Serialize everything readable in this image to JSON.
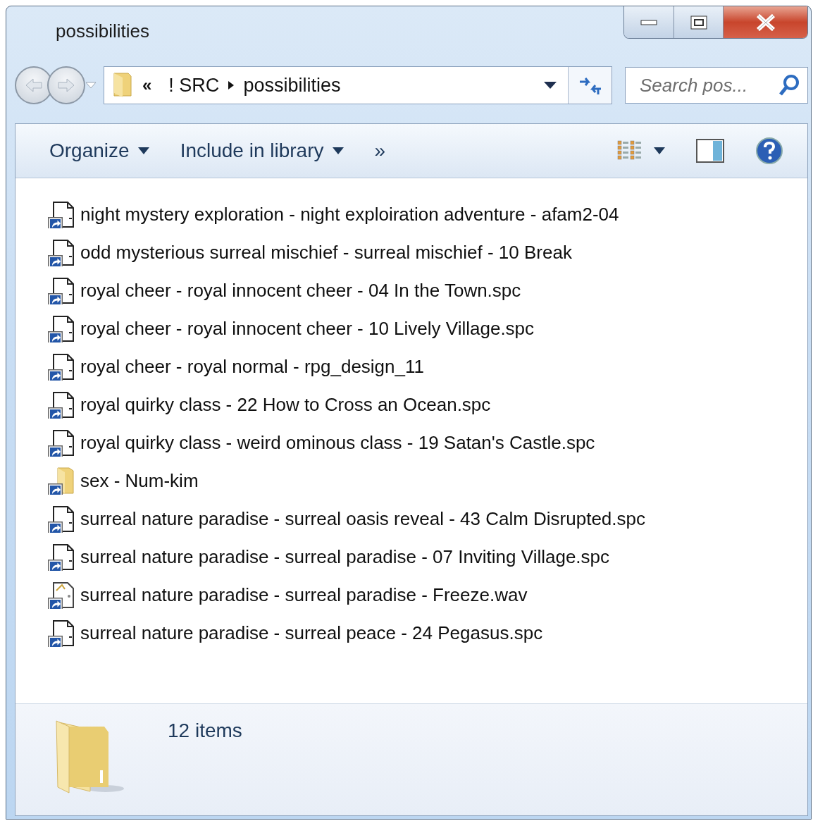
{
  "window": {
    "title": "possibilities"
  },
  "address": {
    "overflow": "«",
    "crumbs": [
      "! SRC",
      "possibilities"
    ]
  },
  "search": {
    "placeholder": "Search pos..."
  },
  "toolbar": {
    "items": [
      {
        "label": "Organize",
        "kind": "menu"
      },
      {
        "label": "Include in library",
        "kind": "menu"
      },
      {
        "label": "»",
        "kind": "more"
      }
    ]
  },
  "files": [
    {
      "name": "night mystery exploration - night exploiration adventure - afam2-04",
      "kind": "file"
    },
    {
      "name": "odd mysterious surreal mischief - surreal mischief - 10 Break",
      "kind": "file"
    },
    {
      "name": "royal cheer - royal innocent cheer - 04 In the Town.spc",
      "kind": "file"
    },
    {
      "name": "royal cheer - royal innocent cheer - 10 Lively Village.spc",
      "kind": "file"
    },
    {
      "name": "royal cheer - royal normal - rpg_design_11",
      "kind": "file"
    },
    {
      "name": "royal quirky class - 22 How to Cross an Ocean.spc",
      "kind": "file"
    },
    {
      "name": "royal quirky class - weird ominous class - 19 Satan's Castle.spc",
      "kind": "file"
    },
    {
      "name": "sex - Num-kim",
      "kind": "folder"
    },
    {
      "name": "surreal nature paradise - surreal oasis reveal - 43 Calm Disrupted.spc",
      "kind": "file"
    },
    {
      "name": "surreal nature paradise - surreal paradise - 07 Inviting Village.spc",
      "kind": "file"
    },
    {
      "name": "surreal nature paradise - surreal paradise - Freeze.wav",
      "kind": "audio"
    },
    {
      "name": "surreal nature paradise - surreal peace - 24 Pegasus.spc",
      "kind": "file"
    }
  ],
  "details": {
    "count": "12 items"
  }
}
